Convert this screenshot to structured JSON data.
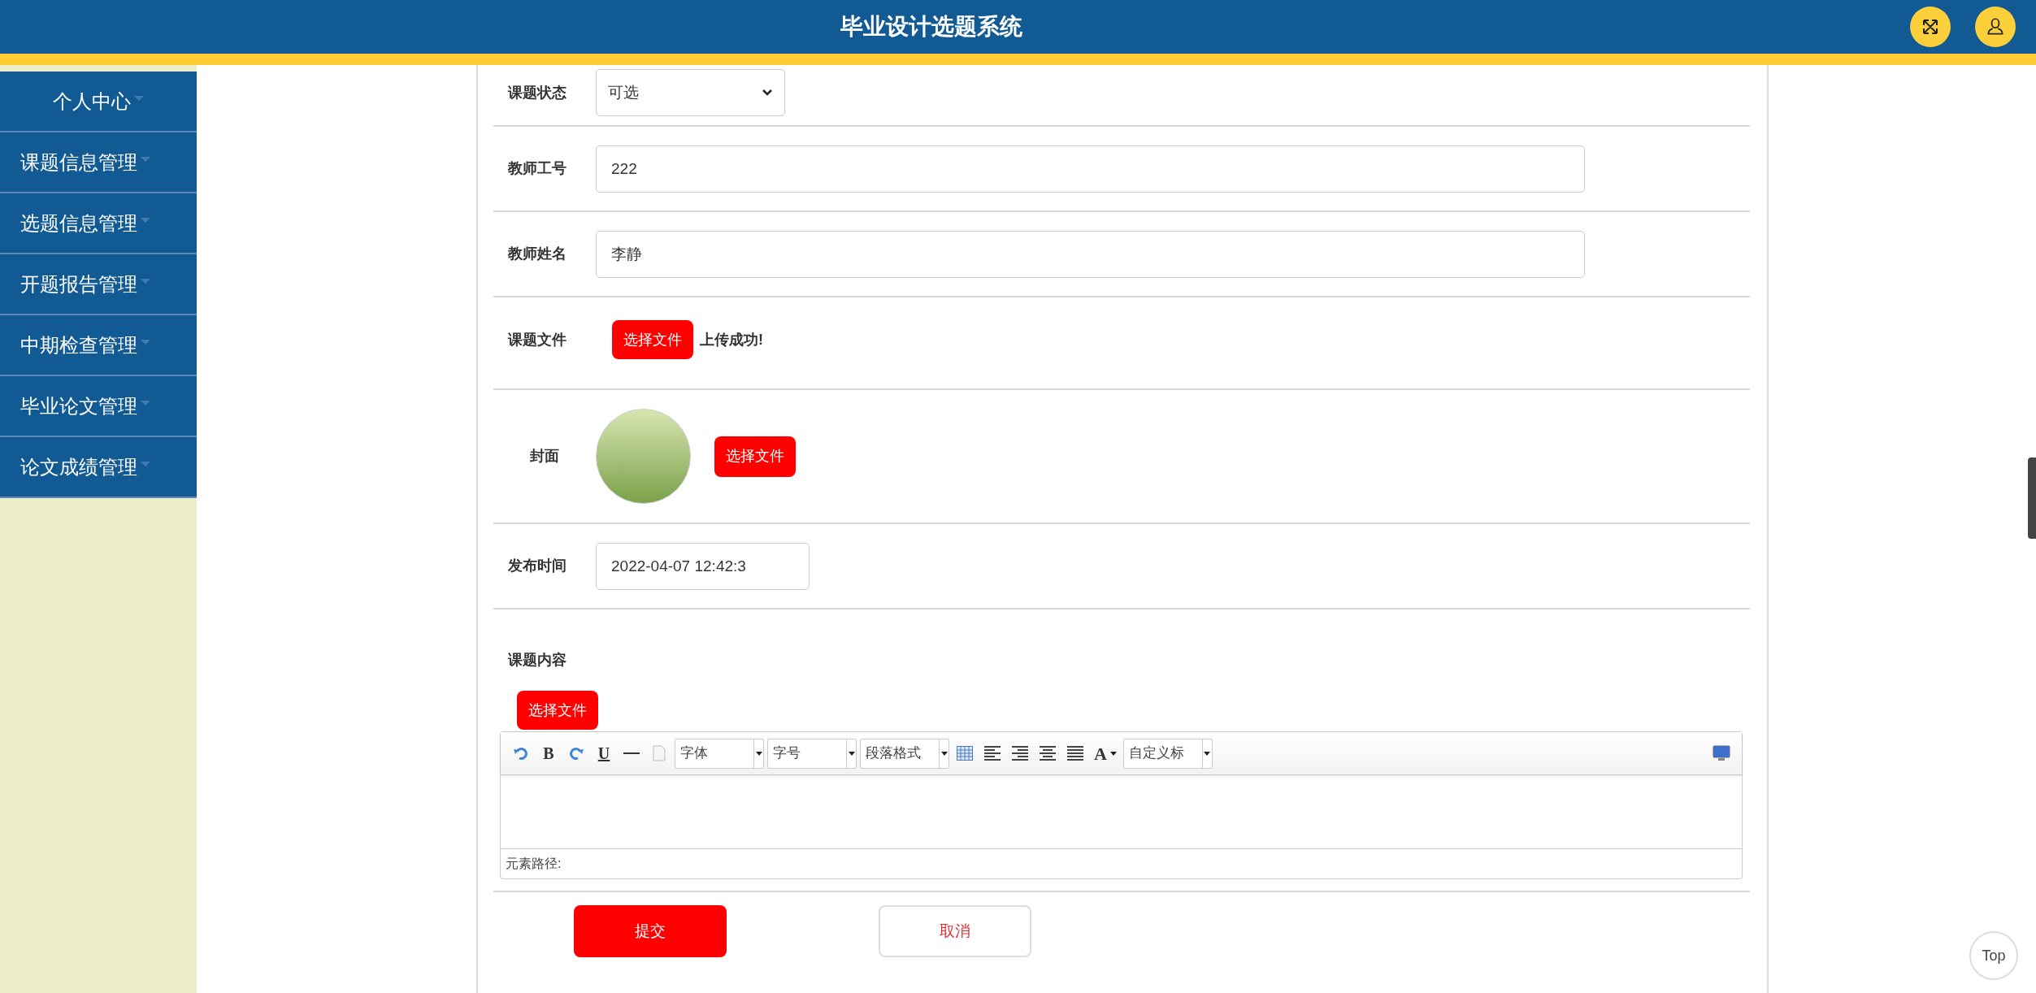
{
  "header": {
    "title": "毕业设计选题系统"
  },
  "sidebar": {
    "items": [
      {
        "label": "个人中心"
      },
      {
        "label": "课题信息管理"
      },
      {
        "label": "选题信息管理"
      },
      {
        "label": "开题报告管理"
      },
      {
        "label": "中期检查管理"
      },
      {
        "label": "毕业论文管理"
      },
      {
        "label": "论文成绩管理"
      }
    ]
  },
  "form": {
    "fields": [
      {
        "kind": "select",
        "label": "课题状态",
        "value": "可选"
      },
      {
        "kind": "text",
        "label": "教师工号",
        "value": "222"
      },
      {
        "kind": "text",
        "label": "教师姓名",
        "value": "李静"
      },
      {
        "kind": "file",
        "label": "课题文件",
        "button": "选择文件",
        "message": "上传成功!"
      },
      {
        "kind": "image",
        "label": "封面",
        "button": "选择文件"
      },
      {
        "kind": "date",
        "label": "发布时间",
        "value": "2022-04-07 12:42:3"
      },
      {
        "kind": "editor",
        "label": "课题内容",
        "button": "选择文件",
        "editor": {
          "toolbar": [
            {
              "kind": "undo"
            },
            {
              "kind": "bold",
              "text": "B"
            },
            {
              "kind": "redo"
            },
            {
              "kind": "underline",
              "text": "U"
            },
            {
              "kind": "rule"
            },
            {
              "kind": "page"
            },
            {
              "kind": "dropdown",
              "text": "字体"
            },
            {
              "kind": "dropdown",
              "text": "字号"
            },
            {
              "kind": "dropdown",
              "text": "段落格式"
            },
            {
              "kind": "table"
            },
            {
              "kind": "alignleft"
            },
            {
              "kind": "alignright"
            },
            {
              "kind": "aligncenter"
            },
            {
              "kind": "justify"
            },
            {
              "kind": "color",
              "text": "A"
            },
            {
              "kind": "dropdown",
              "text": "自定义标"
            },
            {
              "kind": "preview"
            }
          ],
          "status": "元素路径:"
        }
      }
    ],
    "buttons": [
      {
        "kind": "primary",
        "label": "提交"
      },
      {
        "kind": "secondary",
        "label": "取消"
      }
    ]
  },
  "back_to_top": "Top"
}
